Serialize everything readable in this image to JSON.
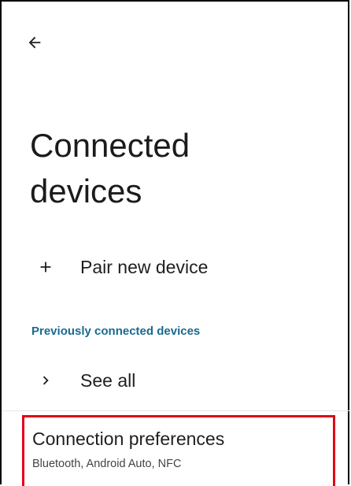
{
  "header": {
    "back_icon": "arrow-back-icon"
  },
  "page": {
    "title": "Connected\ndevices"
  },
  "pair_new_device": {
    "icon": "plus-icon",
    "label": "Pair new device"
  },
  "previously_connected": {
    "header": "Previously connected devices",
    "see_all": {
      "icon": "chevron-right-icon",
      "label": "See all"
    }
  },
  "connection_preferences": {
    "title": "Connection preferences",
    "summary": "Bluetooth, Android Auto, NFC"
  },
  "colors": {
    "accent": "#1a6a8f",
    "highlight_border": "#e2001a",
    "text_primary": "#1f1f1f",
    "text_secondary": "#444444"
  }
}
